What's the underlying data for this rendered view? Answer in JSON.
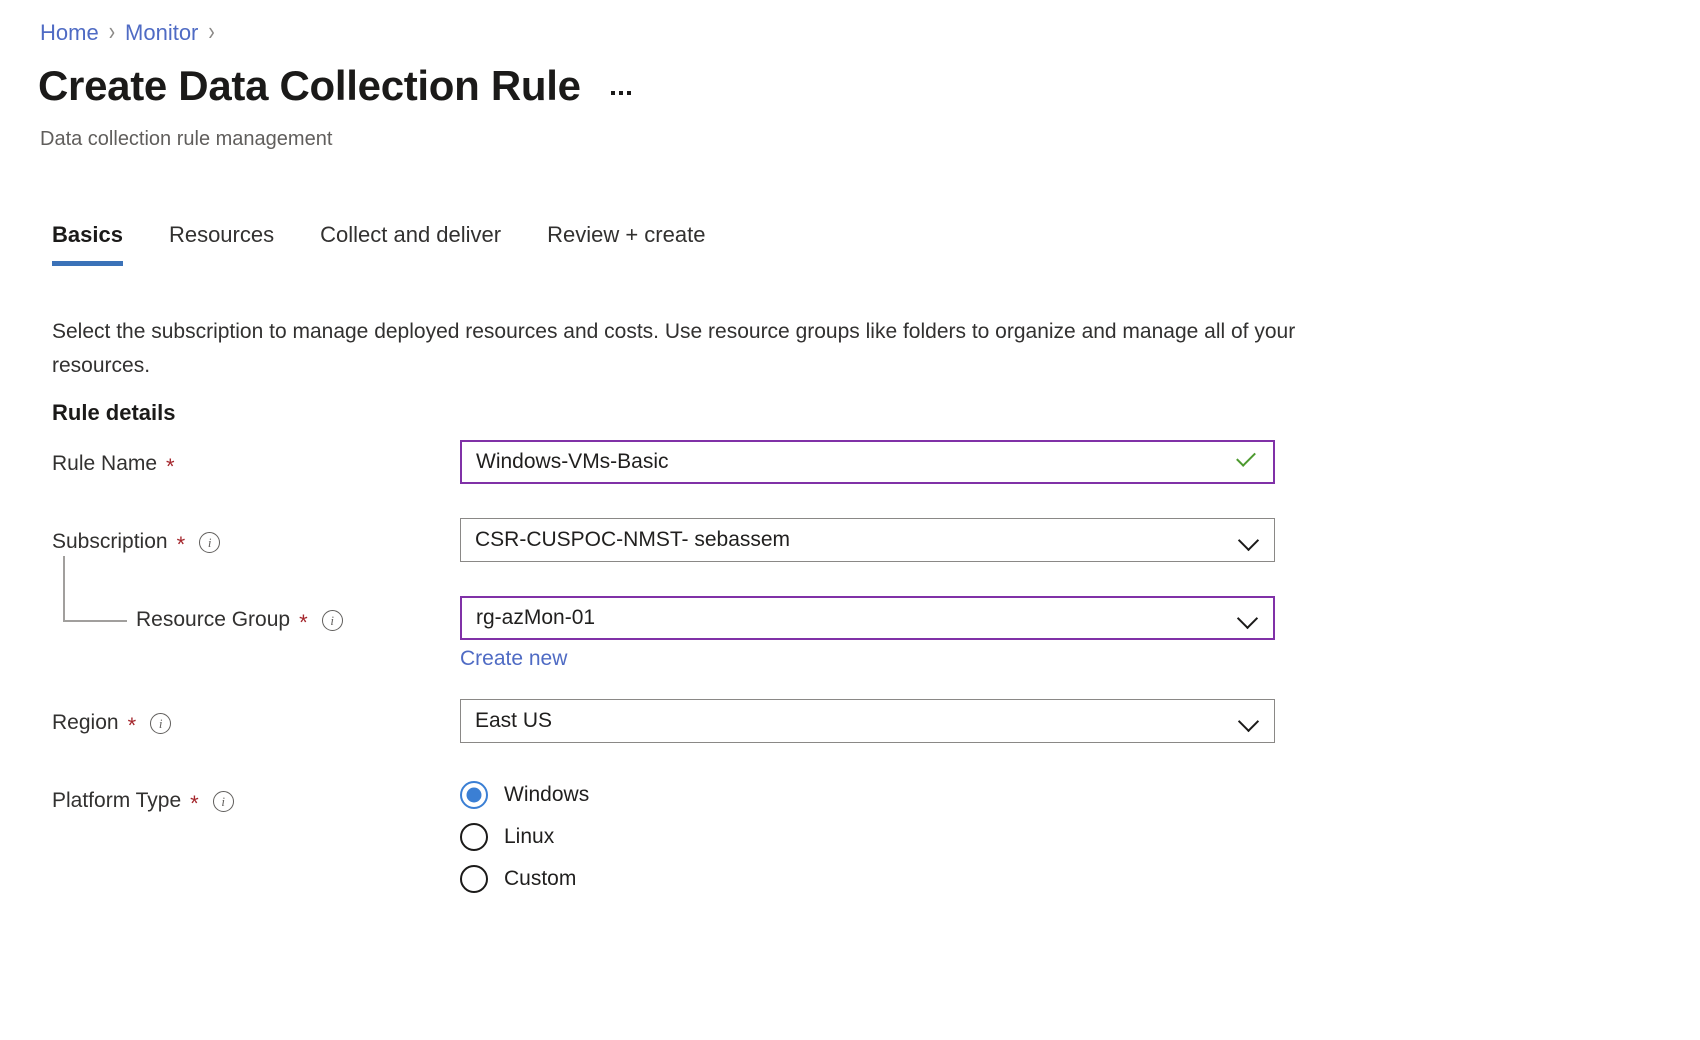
{
  "breadcrumb": {
    "items": [
      {
        "label": "Home"
      },
      {
        "label": "Monitor"
      }
    ],
    "separator": "›"
  },
  "header": {
    "title": "Create Data Collection Rule",
    "subtitle": "Data collection rule management",
    "more_label": "More commands"
  },
  "tabs": [
    {
      "label": "Basics",
      "active": true
    },
    {
      "label": "Resources",
      "active": false
    },
    {
      "label": "Collect and deliver",
      "active": false
    },
    {
      "label": "Review + create",
      "active": false
    }
  ],
  "intro": "Select the subscription to manage deployed resources and costs. Use resource groups like folders to organize and manage all of your resources.",
  "section": {
    "heading": "Rule details"
  },
  "fields": {
    "rule_name": {
      "label": "Rule Name",
      "required": "*",
      "value": "Windows-VMs-Basic",
      "validation": "valid"
    },
    "subscription": {
      "label": "Subscription",
      "required": "*",
      "value": "CSR-CUSPOC-NMST- sebassem"
    },
    "resource_group": {
      "label": "Resource Group",
      "required": "*",
      "value": "rg-azMon-01",
      "create_new_label": "Create new"
    },
    "region": {
      "label": "Region",
      "required": "*",
      "value": "East US"
    },
    "platform_type": {
      "label": "Platform Type",
      "required": "*",
      "options": [
        {
          "label": "Windows",
          "selected": true
        },
        {
          "label": "Linux",
          "selected": false
        },
        {
          "label": "Custom",
          "selected": false
        }
      ]
    }
  },
  "colors": {
    "link": "#4f6bc4",
    "tab_accent": "#3b72b8",
    "focus_border": "#8031a7",
    "required_asterisk": "#a4262c",
    "valid_check": "#4d9a2f",
    "radio_selected": "#3b7fd4"
  }
}
